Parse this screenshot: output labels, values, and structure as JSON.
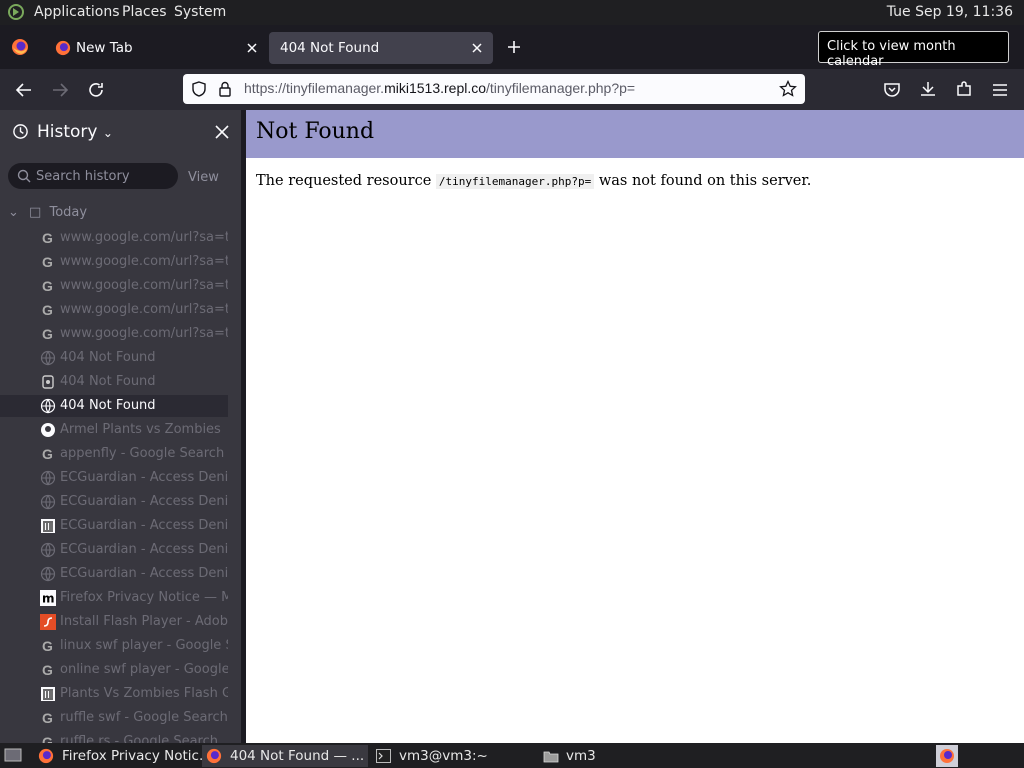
{
  "top_panel": {
    "applications": "Applications",
    "places": "Places",
    "system": "System",
    "clock": "Tue Sep 19, 11:36"
  },
  "tabs": [
    {
      "label": "New Tab"
    },
    {
      "label": "404 Not Found"
    }
  ],
  "tooltip": "Click to view month calendar",
  "urlbar": {
    "url_plain": "https://tinyfilemanager.",
    "url_domain": "miki1513.repl.co",
    "url_path": "/tinyfilemanager.php?p="
  },
  "sidebar": {
    "title": "History",
    "search_placeholder": "Search history",
    "view_label": "View",
    "today_label": "Today",
    "items": [
      {
        "icon": "google-icon",
        "label": "www.google.com/url?sa=t"
      },
      {
        "icon": "google-icon",
        "label": "www.google.com/url?sa=t"
      },
      {
        "icon": "google-icon",
        "label": "www.google.com/url?sa=t"
      },
      {
        "icon": "google-icon",
        "label": "www.google.com/url?sa=t"
      },
      {
        "icon": "google-icon",
        "label": "www.google.com/url?sa=t"
      },
      {
        "icon": "globe-icon",
        "label": "404 Not Found"
      },
      {
        "icon": "replit-icon",
        "label": "404 Not Found"
      },
      {
        "icon": "globe-icon",
        "label": "404 Not Found"
      },
      {
        "icon": "github-icon",
        "label": "Armel Plants vs Zombies"
      },
      {
        "icon": "google-icon",
        "label": "appenfly - Google Search"
      },
      {
        "icon": "globe-icon",
        "label": "ECGuardian - Access Denie"
      },
      {
        "icon": "globe-icon",
        "label": "ECGuardian - Access Denie"
      },
      {
        "icon": "archive-icon",
        "label": "ECGuardian - Access Denie"
      },
      {
        "icon": "globe-icon",
        "label": "ECGuardian - Access Denie"
      },
      {
        "icon": "globe-icon",
        "label": "ECGuardian - Access Denie"
      },
      {
        "icon": "mozilla-icon",
        "label": "Firefox Privacy Notice — M"
      },
      {
        "icon": "flash-icon",
        "label": "Install Flash Player - Adobe"
      },
      {
        "icon": "google-icon",
        "label": "linux swf player - Google Se"
      },
      {
        "icon": "google-icon",
        "label": "online swf player - Google"
      },
      {
        "icon": "archive-icon",
        "label": "Plants Vs Zombies Flash G"
      },
      {
        "icon": "google-icon",
        "label": "ruffle swf - Google Search"
      },
      {
        "icon": "google-icon",
        "label": "ruffle.rs - Google Search"
      }
    ],
    "selected_index": 7
  },
  "content": {
    "title": "Not Found",
    "msg_before": "The requested resource ",
    "msg_code": "/tinyfilemanager.php?p=",
    "msg_after": " was not found on this server."
  },
  "taskbar": {
    "items": [
      {
        "label": "Firefox Privacy Notic..."
      },
      {
        "label": "404 Not Found — ..."
      },
      {
        "label": "vm3@vm3:~"
      },
      {
        "label": "vm3"
      }
    ]
  },
  "colors": {
    "banner": "#9999cc",
    "chrome_dark": "#1c1b22",
    "sidebar_bg": "#38373f"
  }
}
